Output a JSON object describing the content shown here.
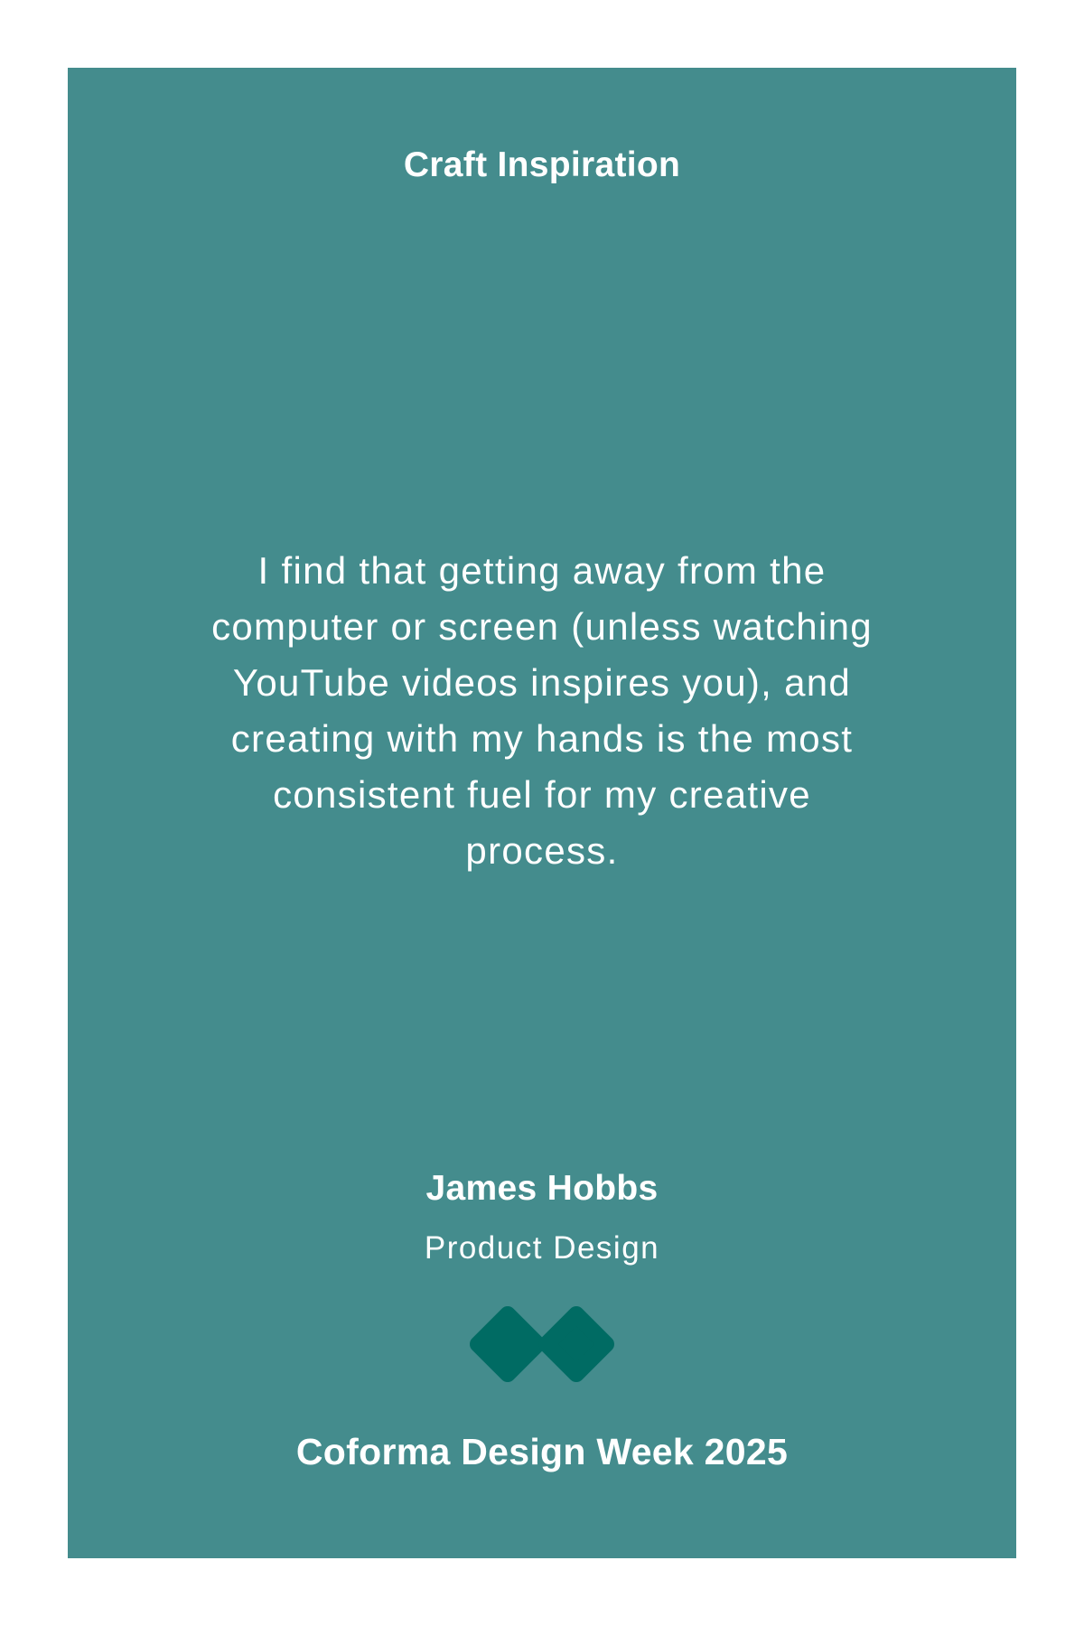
{
  "card": {
    "background_color": "#448c8d",
    "heading": "Craft Inspiration",
    "quote": "I find that getting away from the computer or screen (unless watching YouTube videos inspires you), and creating with my hands is the most consistent fuel for my creative process.",
    "author": {
      "name": "James Hobbs",
      "role": "Product Design"
    },
    "logo": {
      "icon": "double-diamond-logo-icon",
      "color": "#006b63"
    },
    "footer": "Coforma Design Week 2025"
  }
}
